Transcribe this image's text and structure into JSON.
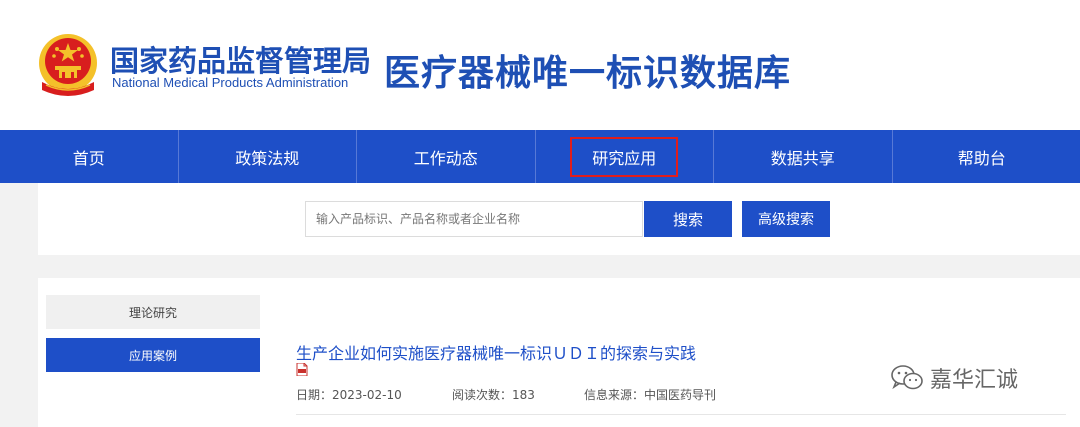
{
  "header": {
    "org_name_cn": "国家药品监督管理局",
    "org_name_en": "National Medical Products  Administration",
    "site_title": "医疗器械唯一标识数据库"
  },
  "nav": {
    "items": [
      {
        "label": "首页"
      },
      {
        "label": "政策法规"
      },
      {
        "label": "工作动态"
      },
      {
        "label": "研究应用",
        "highlighted": true
      },
      {
        "label": "数据共享"
      },
      {
        "label": "帮助台"
      }
    ]
  },
  "search": {
    "placeholder": "输入产品标识、产品名称或者企业名称",
    "search_label": "搜索",
    "advanced_label": "高级搜索"
  },
  "sidebar": {
    "items": [
      {
        "label": "理论研究"
      },
      {
        "label": "应用案例",
        "active": true
      }
    ]
  },
  "article": {
    "title": "生产企业如何实施医疗器械唯一标识ＵＤＩ的探索与实践",
    "date": "日期：2023-02-10",
    "reads": "阅读次数：183",
    "source": "信息来源：中国医药导刊",
    "attachment_icon": "pdf-icon"
  },
  "watermark": {
    "text": "嘉华汇诚"
  },
  "colors": {
    "brand_blue": "#1e4fc8",
    "highlight_red": "#e11d1d",
    "emblem_red": "#d81e1e",
    "emblem_gold": "#f4c12a"
  }
}
